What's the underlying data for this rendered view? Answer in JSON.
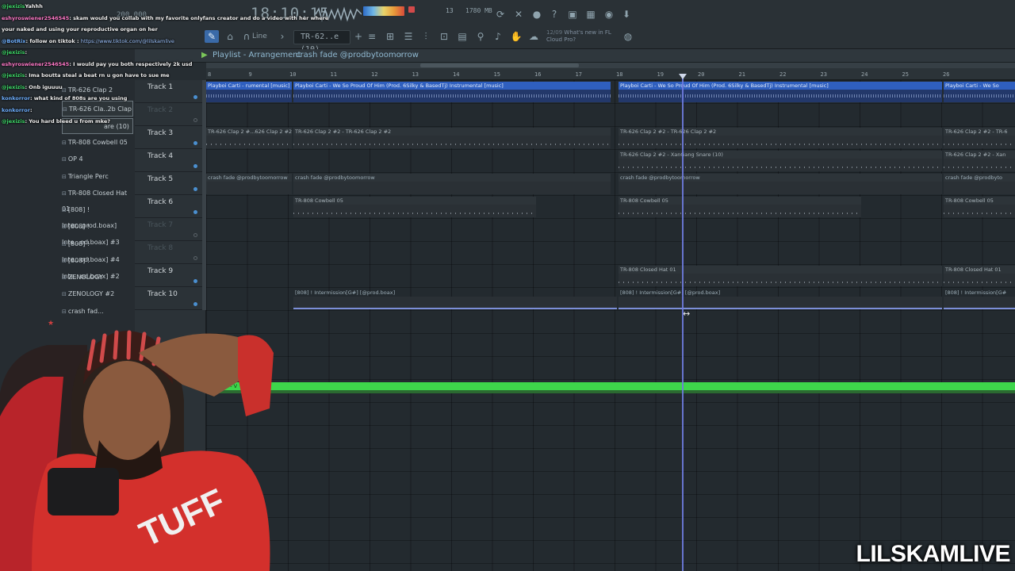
{
  "toolbar": {
    "time": "18:10:15",
    "tempo": "200.000",
    "beat_num": "13",
    "cpu": "1780 MB",
    "cpu2": "0",
    "pattern": "TR-62..e (10)",
    "snap": "Line",
    "news_date": "12/09",
    "news_line1": "What's new in FL",
    "news_line2": "Cloud Pro?",
    "colors": {
      "accent": "#8fb8d0",
      "rec": "#d34a4a"
    },
    "icons": [
      "metronome-icon",
      "wait-icon",
      "countdown-icon",
      "loop-icon",
      "cut-icon",
      "mic-icon",
      "help-icon",
      "save-icon",
      "ram-icon",
      "chat-icon",
      "download-icon",
      "globe-icon"
    ]
  },
  "playlist": {
    "title_prefix": "Playlist - Arrangement",
    "title_pattern": "crash fade @prodbytoomorrow",
    "bars": [
      "8",
      "9",
      "10",
      "11",
      "12",
      "13",
      "14",
      "15",
      "16",
      "17",
      "18",
      "19",
      "20",
      "21",
      "22",
      "23",
      "24",
      "25",
      "26"
    ],
    "tracks": [
      {
        "name": "Track 1",
        "active": true
      },
      {
        "name": "Track 2",
        "active": false
      },
      {
        "name": "Track 3",
        "active": true
      },
      {
        "name": "Track 4",
        "active": true
      },
      {
        "name": "Track 5",
        "active": true
      },
      {
        "name": "Track 6",
        "active": true
      },
      {
        "name": "Track 7",
        "active": false
      },
      {
        "name": "Track 8",
        "active": false
      },
      {
        "name": "Track 9",
        "active": true
      },
      {
        "name": "Track 10",
        "active": true
      }
    ],
    "clips": {
      "t1a": "Playboi Carti - rumental [music]",
      "t1b": "Playboi Carti - We So Proud Of Him (Prod. 6Silky & BasedTj) Instrumental [music]",
      "t1c": "Playboi Carti - We So Proud Of Him (Prod. 6Silky & BasedTj) Instrumental [music]",
      "t1d": "Playboi Carti - We So",
      "t3a": "TR-626 Clap 2 #...626 Clap 2 #2",
      "t3b": "TR-626 Clap 2 #2 - TR-626 Clap 2 #2",
      "t3c": "TR-626 Clap 2 #2 - TR-626 Clap 2 #2",
      "t3d": "TR-626 Clap 2 #2 - TR-6",
      "t4a": "TR-626 Clap 2 #2 - XanGang Snare (10)",
      "t4b": "TR-626 Clap 2 #2 - Xan",
      "t5a": "crash fade @prodbytoomorrow",
      "t5b": "crash fade @prodbytoomorrow",
      "t5c": "crash fade @prodbytoomorrow",
      "t5d": "crash fade @prodbyto",
      "t6a": "TR-808 Cowbell 05",
      "t6b": "TR-808 Cowbell 05",
      "t6c": "TR-808 Cowbell 05",
      "t9a": "TR-808 Closed Hat 01",
      "t9b": "TR-808 Closed Hat 01",
      "t10a": "[808] ! Intermission[G#] [@prod.boax]",
      "t10b": "[808] ! Intermission[G#] [@prod.boax]",
      "t10c": "[808] ! Intermission[G#"
    },
    "master_label": "Master - V"
  },
  "browser": {
    "items": [
      "TR-626 Cla..2b Clap 2 #2",
      "are (10)",
      "TR-808 Cowbell 05",
      "OP 4",
      "Triangle Perc",
      "TR-808 Closed Hat 01",
      "[808] ! Inter...prod.boax]",
      "[808] ! Inte...od.boax] #3",
      "[808] ! Inte...od.boax] #4",
      "[808] ! Inte...od.boax] #2",
      "ZENOLOGY",
      "ZENOLOGY #2",
      "crash fad..."
    ],
    "top_item": "TR-626 Clap 2"
  },
  "chat": [
    {
      "user": "@jexizis",
      "msg": "Yahhh",
      "color": "g"
    },
    {
      "user": "eshyroswiener2546545",
      "msg": ": skam would you collab with my favorite onlyfans creator and do a video with her where",
      "color": "p"
    },
    {
      "user": "",
      "msg": "your naked and using your reproductive organ on her",
      "color": ""
    },
    {
      "user": "@BotRix",
      "msg": ": follow on tiktok : ",
      "link": "https://www.tiktok.com/@lilskamlive",
      "color": "b"
    },
    {
      "user": "@jexizis",
      "msg": ":",
      "color": "g"
    },
    {
      "user": "eshyroswiener2546545",
      "msg": ": I would pay you both respectively 2k usd",
      "color": "p"
    },
    {
      "user": "@jexizis",
      "msg": ": Ima boutta steal a beat rn u gon have to sue me",
      "color": "g"
    },
    {
      "user": "@jexizis",
      "msg": ": Onb iguuuu",
      "color": "g"
    },
    {
      "user": "konkorror",
      "msg": ": what kind of 808s are you using",
      "color": "b"
    },
    {
      "user": "konkorror",
      "msg": ":",
      "color": "b"
    },
    {
      "user": "@jexizis",
      "msg": ": You hard bleed u from mke?",
      "color": "g"
    }
  ],
  "watermark": "LILSKAMLIVE"
}
